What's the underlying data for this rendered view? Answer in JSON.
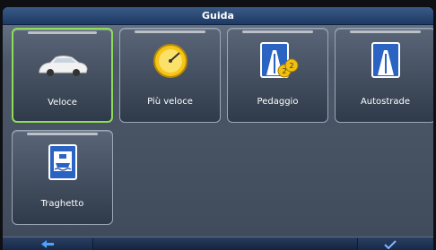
{
  "window": {
    "title": "Guida"
  },
  "tiles": [
    {
      "label": "Veloce",
      "icon": "car-icon",
      "selected": true
    },
    {
      "label": "Più veloce",
      "icon": "speedometer-icon",
      "selected": false
    },
    {
      "label": "Pedaggio",
      "icon": "toll-road-icon",
      "selected": false
    },
    {
      "label": "Autostrade",
      "icon": "motorway-icon",
      "selected": false
    },
    {
      "label": "Traghetto",
      "icon": "ferry-icon",
      "selected": false
    }
  ],
  "toll_coin_text": "2",
  "bottom": {
    "back_icon": "back-arrow-icon",
    "confirm_icon": "checkmark-icon"
  },
  "colors": {
    "accent_selected": "#8fdc5a",
    "titlebar": "#1d3a63"
  }
}
